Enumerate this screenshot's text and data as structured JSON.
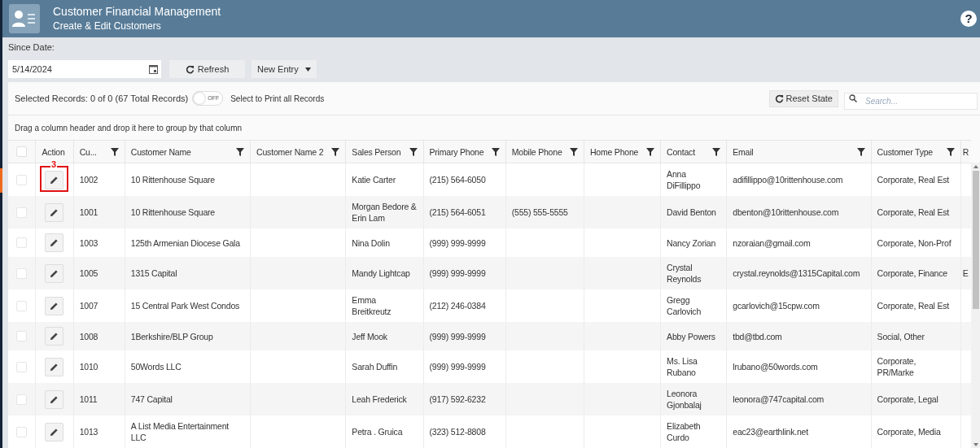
{
  "header": {
    "title": "Customer Financial Management",
    "subtitle": "Create & Edit Customers",
    "help": "?"
  },
  "toolbar": {
    "since_label": "Since Date:",
    "date_value": "5/14/2024",
    "refresh": "Refresh",
    "new_entry": "New Entry"
  },
  "selection_bar": {
    "text": "Selected Records: 0 of 0 (67 Total Records)",
    "toggle": {
      "on": false,
      "label": "OFF"
    },
    "toggle_caption": "Select to Print all Records",
    "reset": "Reset State",
    "search_placeholder": "Search..."
  },
  "group_hint": "Drag a column header and drop it here to group by that column",
  "table": {
    "select_all_checked": false,
    "action_label": "Action",
    "columns": [
      {
        "label": "Cu...",
        "filter": true
      },
      {
        "label": "Customer Name",
        "filter": true
      },
      {
        "label": "Customer Name 2",
        "filter": true
      },
      {
        "label": "Sales Person",
        "filter": true
      },
      {
        "label": "Primary Phone",
        "filter": true
      },
      {
        "label": "Mobile Phone",
        "filter": true
      },
      {
        "label": "Home Phone",
        "filter": true
      },
      {
        "label": "Contact",
        "filter": true
      },
      {
        "label": "Email",
        "filter": true
      },
      {
        "label": "Customer Type",
        "filter": true
      },
      {
        "label": "R",
        "filter": false
      }
    ],
    "rows": [
      {
        "checked": false,
        "callout": "3",
        "cells": [
          "1002",
          "10 Rittenhouse Square",
          "",
          "Katie Carter",
          "(215) 564-6050",
          "",
          "",
          "Anna DiFillippo",
          "adifillippo@10rittenhouse.com",
          "Corporate, Real Est",
          ""
        ]
      },
      {
        "checked": false,
        "cells": [
          "1001",
          "10 Rittenhouse Square",
          "",
          "Morgan Bedore & Erin Lam",
          "(215) 564-6051",
          "(555) 555-5555",
          "",
          "David Benton",
          "dbenton@10rittenhouse.com",
          "Corporate, Real Est",
          ""
        ]
      },
      {
        "checked": false,
        "cells": [
          "1003",
          "125th Armenian Diocese Gala",
          "",
          "Nina Dolin",
          "(999) 999-9999",
          "",
          "",
          "Nancy Zorian",
          "nzoraian@gmail.com",
          "Corporate, Non-Prof",
          ""
        ]
      },
      {
        "checked": false,
        "cells": [
          "1005",
          "1315 Capital",
          "",
          "Mandy Lightcap",
          "(999) 999-9999",
          "",
          "",
          "Crystal Reynolds",
          "crystal.reynolds@1315Capital.com",
          "Corporate, Finance",
          "E"
        ]
      },
      {
        "checked": false,
        "cells": [
          "1007",
          "15 Central Park West Condos",
          "",
          "Emma Breitkreutz",
          "(212) 246-0384",
          "",
          "",
          "Gregg Carlovich",
          "gcarlovich@15cpw.com",
          "Corporate, Real Est",
          ""
        ]
      },
      {
        "checked": false,
        "cells": [
          "1008",
          "1Berkshire/BLP Group",
          "",
          "Jeff Mook",
          "(999) 999-9999",
          "",
          "",
          "Abby Powers",
          "tbd@tbd.com",
          "Social, Other",
          ""
        ]
      },
      {
        "checked": false,
        "cells": [
          "1010",
          "50Words LLC",
          "",
          "Sarah Duffin",
          "(999) 999-9999",
          "",
          "",
          "Ms. Lisa Rubano",
          "lrubano@50words.com",
          "Corporate, PR/Marke",
          ""
        ]
      },
      {
        "checked": false,
        "cells": [
          "1011",
          "747 Capital",
          "",
          "Leah Frederick",
          "(917) 592-6232",
          "",
          "",
          "Leonora Gjonbalaj",
          "leonora@747capital.com",
          "Corporate, Legal",
          ""
        ]
      },
      {
        "checked": false,
        "cells": [
          "1013",
          "A List Media Entertainment LLC",
          "",
          "Petra . Gruica",
          "(323) 512-8808",
          "",
          "",
          "Elizabeth Curdo",
          "eac23@earthlink.net",
          "Corporate, Media",
          ""
        ]
      }
    ]
  }
}
